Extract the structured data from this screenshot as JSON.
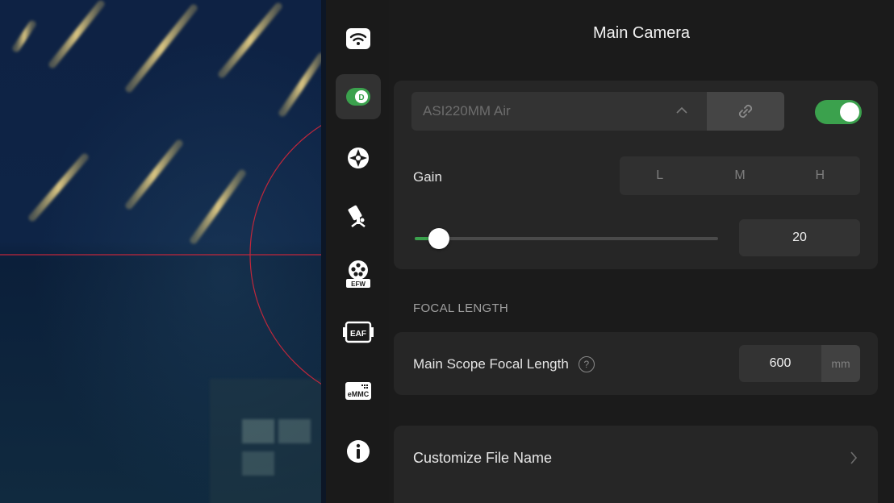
{
  "header": {
    "title": "Main Camera"
  },
  "rail": {
    "items": [
      {
        "icon": "wifi-icon"
      },
      {
        "icon": "camera-toggle-icon",
        "active": true
      },
      {
        "icon": "guide-crosshair-icon"
      },
      {
        "icon": "telescope-mount-icon"
      },
      {
        "icon": "filter-wheel-icon",
        "badge": "EFW"
      },
      {
        "icon": "focuser-icon",
        "badge": "EAF"
      },
      {
        "icon": "storage-icon",
        "badge": "eMMC"
      },
      {
        "icon": "info-icon"
      }
    ]
  },
  "camera": {
    "selected": "ASI220MM Air",
    "enabled": true,
    "gain_label": "Gain",
    "gain_options": [
      "L",
      "M",
      "H"
    ],
    "gain_value": "20",
    "slider_fraction": 0.08
  },
  "focal": {
    "section_label": "FOCAL LENGTH",
    "label": "Main Scope Focal Length",
    "help": "?",
    "value": "600",
    "unit": "mm"
  },
  "file": {
    "label": "Customize File Name"
  },
  "colors": {
    "accent": "#3ba14d",
    "panel": "#1b1b1b",
    "card": "#262626",
    "reticle": "#c0273b"
  }
}
